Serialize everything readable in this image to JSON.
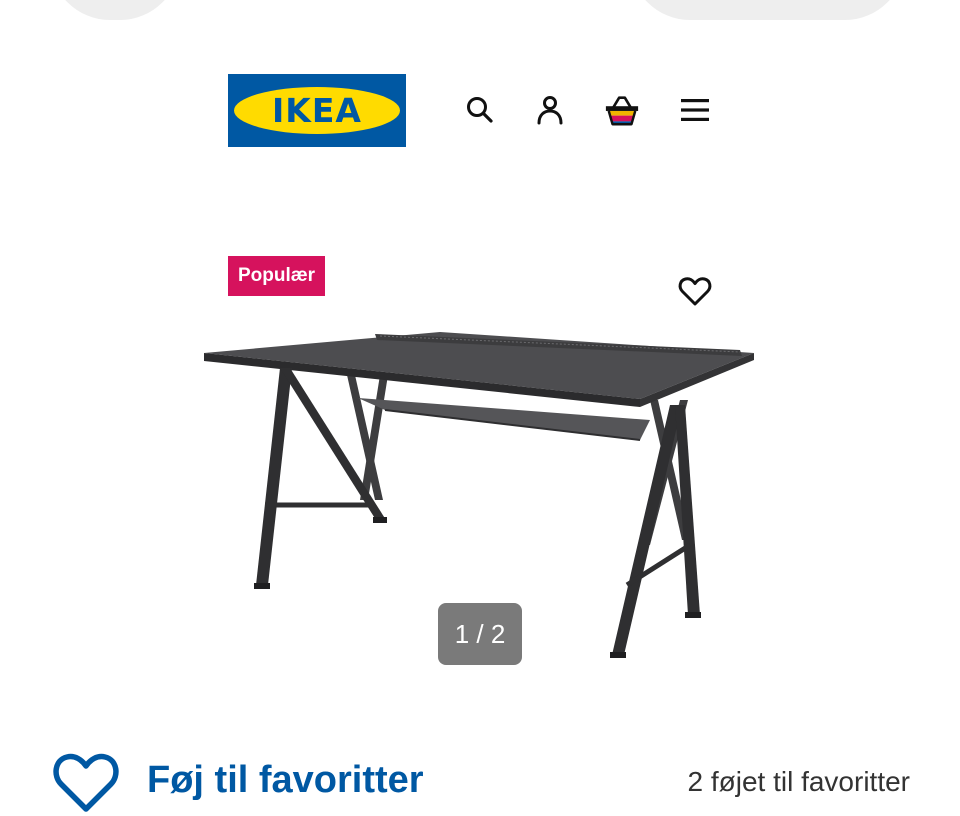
{
  "logo": {
    "text": "IKEA",
    "reg_mark": "®",
    "colors": {
      "blue": "#0058a3",
      "yellow": "#ffdb00"
    }
  },
  "header_icons": [
    "search-icon",
    "user-icon",
    "basket-icon",
    "menu-icon"
  ],
  "product": {
    "badge": "Populær",
    "badge_color": "#d6125d",
    "image_counter": "1 / 2"
  },
  "favorites": {
    "add_label": "Føj til favoritter",
    "count_text": "2 føjet til favoritter",
    "accent_color": "#0058a3"
  }
}
